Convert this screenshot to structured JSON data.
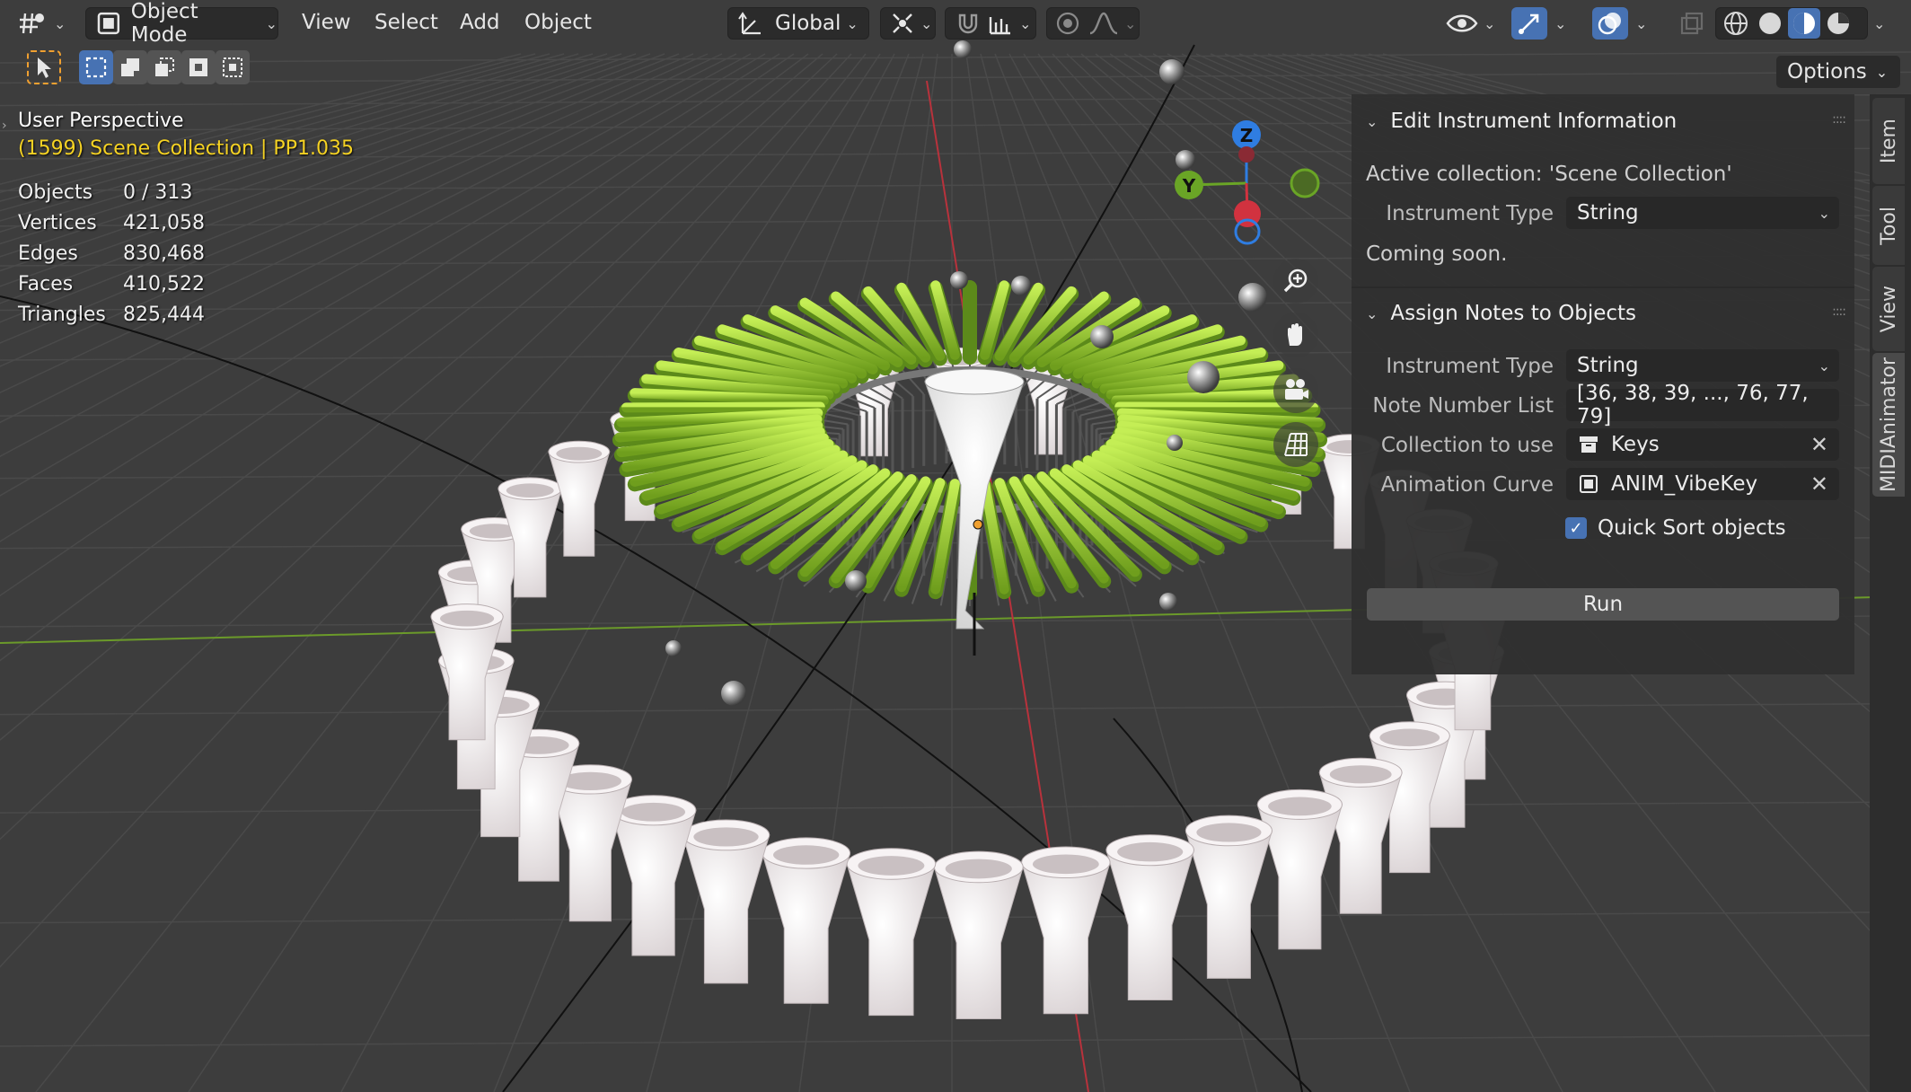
{
  "header": {
    "editor_type_icon": "grid-editor-icon",
    "mode": "Object Mode",
    "menus": [
      "View",
      "Select",
      "Add",
      "Object"
    ],
    "transform_orientation": "Global",
    "pivot_icon": "pivot-point-icon",
    "snap_icon": "magnet-icon",
    "snap_increment_icon": "snap-increment-icon",
    "proportional_icon": "proportional-edit-icon",
    "falloff_icon": "falloff-curve-icon",
    "visibility_icon": "eye-icon",
    "gizmo_icon": "gizmo-icon",
    "overlay_icon": "overlay-icon",
    "xray_icon": "xray-icon",
    "shading_modes": [
      "wireframe",
      "solid",
      "material-preview",
      "rendered"
    ],
    "active_shading": "material-preview"
  },
  "toolbar2": {
    "select_tool_icon": "cursor-arrow-icon",
    "select_modes": [
      "box-select-new",
      "extend",
      "subtract",
      "invert",
      "intersect"
    ],
    "options_label": "Options"
  },
  "overlay": {
    "perspective": "User Perspective",
    "collection": "(1599) Scene Collection | PP1.035",
    "stats": [
      {
        "label": "Objects",
        "value": "0 / 313"
      },
      {
        "label": "Vertices",
        "value": "421,058"
      },
      {
        "label": "Edges",
        "value": "830,468"
      },
      {
        "label": "Faces",
        "value": "410,522"
      },
      {
        "label": "Triangles",
        "value": "825,444"
      }
    ]
  },
  "gizmo": {
    "axes": [
      "Z",
      "Y"
    ],
    "nav_buttons": [
      "zoom-icon",
      "hand-pan-icon",
      "camera-icon",
      "grid-ortho-icon"
    ]
  },
  "panel": {
    "edit_section": {
      "title": "Edit Instrument Information",
      "active_collection": "Active collection: 'Scene Collection'",
      "instrument_type_label": "Instrument Type",
      "instrument_type_value": "String",
      "coming_soon": "Coming soon."
    },
    "assign_section": {
      "title": "Assign Notes to Objects",
      "instrument_type_label": "Instrument Type",
      "instrument_type_value": "String",
      "note_list_label": "Note Number List",
      "note_list_value": "[36, 38, 39, ..., 76, 77, 79]",
      "collection_label": "Collection to use",
      "collection_value": "Keys",
      "curve_label": "Animation Curve",
      "curve_value": "ANIM_VibeKey",
      "quick_sort_label": "Quick Sort objects",
      "quick_sort_checked": true,
      "run_label": "Run"
    }
  },
  "side_tabs": [
    "Item",
    "Tool",
    "View",
    "MIDIAnimator"
  ],
  "active_tab": "MIDIAnimator",
  "colors": {
    "accent": "#4772b3",
    "collection_text": "#f5d223",
    "axis_x": "#d1323f",
    "axis_y": "#6aa526",
    "axis_z": "#2f7de1",
    "key_green": "#9fd23a",
    "tube_white": "#f2eeee"
  }
}
